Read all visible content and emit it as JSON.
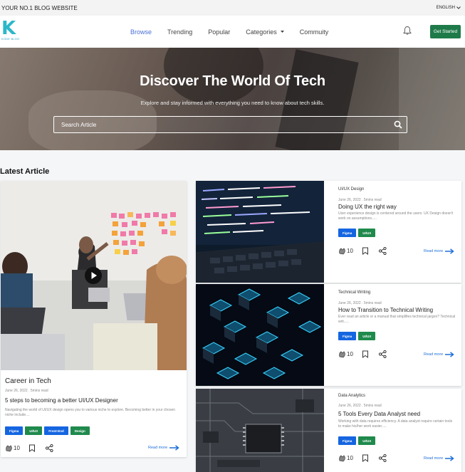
{
  "topbar": {
    "tagline": "YOUR NO.1 BLOG WEBSITE",
    "language": "ENGLISH"
  },
  "logo": {
    "letter": "K",
    "text": "KODE BLOG"
  },
  "nav": {
    "items": [
      "Browse",
      "Trending",
      "Popular",
      "Categories",
      "Commuity"
    ],
    "cta": "Get Started"
  },
  "hero": {
    "title": "Discover The World Of Tech",
    "subtitle": "Explore and stay informed with everything you need to know about tech skills.",
    "search_placeholder": "Search Article"
  },
  "section_title": "Latest Article",
  "featured": {
    "category": "Career in Tech",
    "date": "June 26, 2022 . 5mins read",
    "title": "5 steps to becoming a better UI/UX Designer",
    "description": "Navigating the world of UI/UX design opens you to various niche to explore. Becoming better in your chosen niche include....",
    "tags": [
      "Figma",
      "UI/UX",
      "Front-End",
      "Design"
    ],
    "likes": "10",
    "read_more": "Read more"
  },
  "articles": [
    {
      "category": "UI/UX Design",
      "date": "June 26, 2022 . 5mins read",
      "title": "Doing UX the right way",
      "description": "User experience design is centered around the users. UX Design doesn't work on assumptions.....",
      "tags": [
        "Figma",
        "UI/UX"
      ],
      "likes": "10",
      "read_more": "Read more"
    },
    {
      "category": "Technical Writing",
      "date": "June 26, 2022 . 5mins read",
      "title": "How to Transition to Technical Writing",
      "description": "Ever read an article or a manual that simplifies technical jargon? Technical writ.....",
      "tags": [
        "Figma",
        "UI/UX"
      ],
      "likes": "10",
      "read_more": "Read more"
    },
    {
      "category": "Data Analytics",
      "date": "June 26, 2022 . 5mins read",
      "title": "5 Tools Every Data Analyst need",
      "description": "Working with data requires efficiency. A data analyst require certain tools to make his/her work easier.....",
      "tags": [
        "Figma",
        "UI/UX"
      ],
      "likes": "10",
      "read_more": "Read more"
    }
  ],
  "colors": {
    "accent": "#1f7a4a",
    "link": "#1e6fd9",
    "tag_blue": "#1565e0",
    "tag_green": "#1f8a4c"
  }
}
